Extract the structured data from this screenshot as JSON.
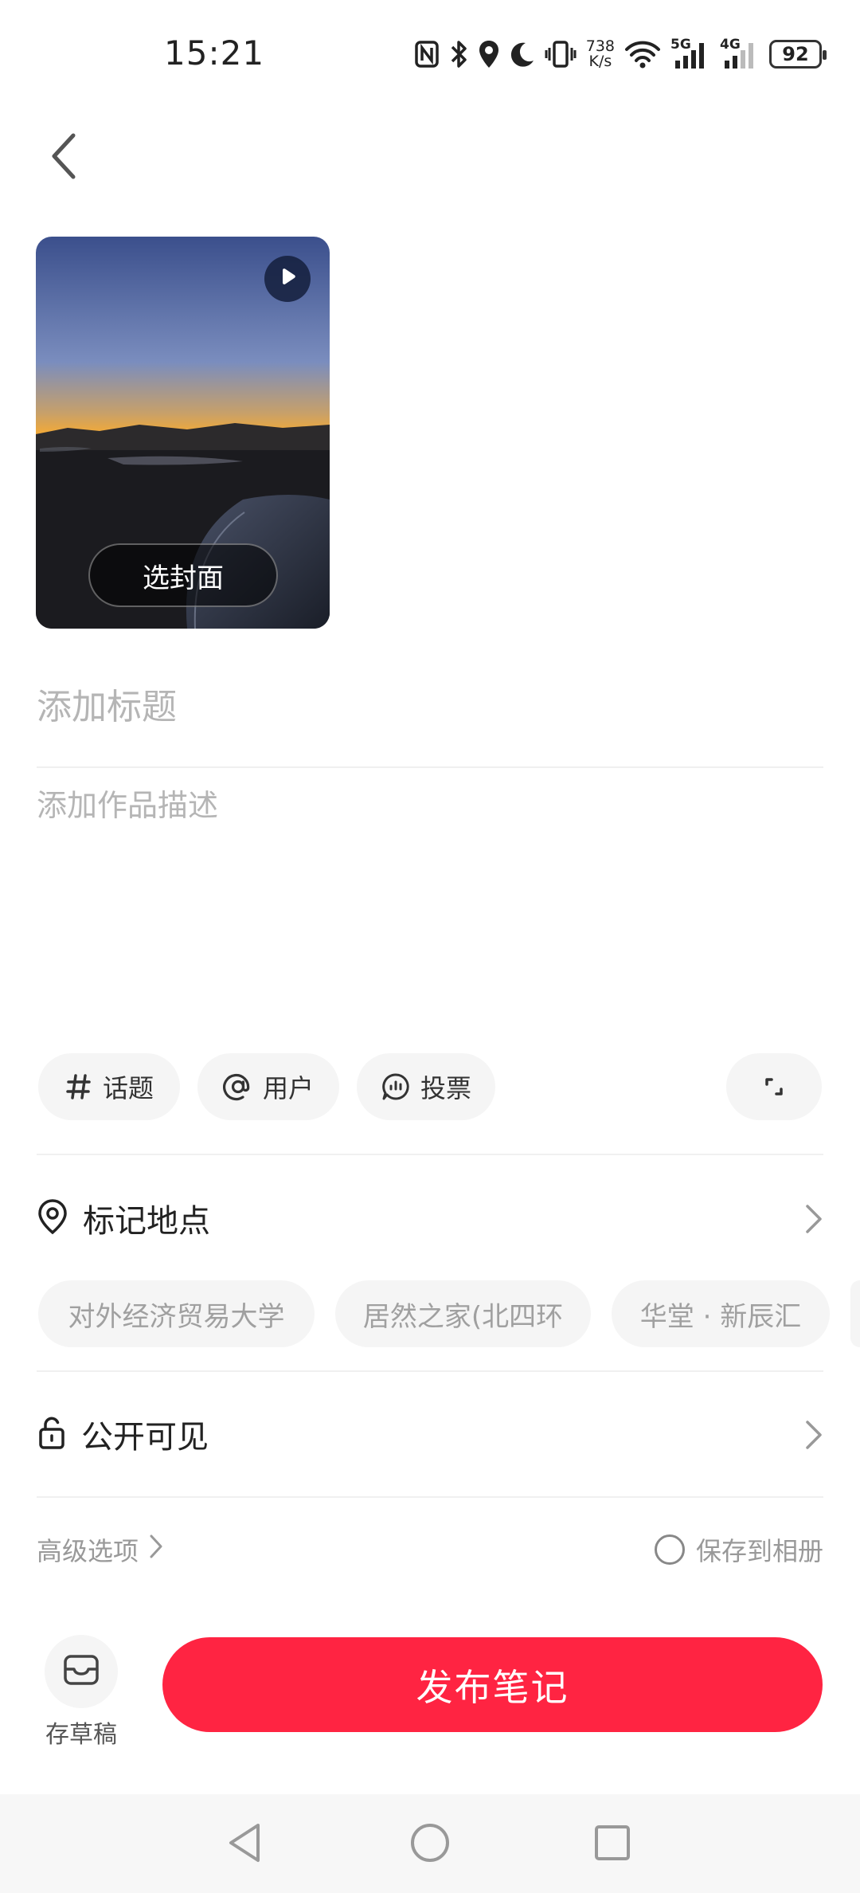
{
  "status_bar": {
    "time": "15:21",
    "net_speed_value": "738",
    "net_speed_unit": "K/s",
    "signal1_label": "5G",
    "signal2_label": "4G",
    "battery": "92"
  },
  "cover": {
    "select_cover_label": "选封面"
  },
  "form": {
    "title_placeholder": "添加标题",
    "title_value": "",
    "description_placeholder": "添加作品描述",
    "description_value": ""
  },
  "tools": {
    "topic_label": "话题",
    "user_label": "用户",
    "vote_label": "投票"
  },
  "location": {
    "label": "标记地点",
    "suggestions": [
      "对外经济贸易大学",
      "居然之家(北四环",
      "华堂 · 新辰汇"
    ]
  },
  "visibility": {
    "label": "公开可见"
  },
  "options": {
    "advanced_label": "高级选项",
    "save_album_label": "保存到相册",
    "save_album_checked": false
  },
  "footer": {
    "draft_label": "存草稿",
    "publish_label": "发布笔记"
  },
  "colors": {
    "accent": "#ff2442",
    "chip_bg": "#f5f5f5",
    "placeholder": "#b5b5b5"
  },
  "icons": {
    "back": "chevron-left-icon",
    "play": "play-icon",
    "topic": "hash-icon",
    "user": "at-icon",
    "vote": "vote-icon",
    "expand": "expand-icon",
    "location": "location-pin-icon",
    "visibility": "unlock-icon",
    "draft": "inbox-icon"
  }
}
